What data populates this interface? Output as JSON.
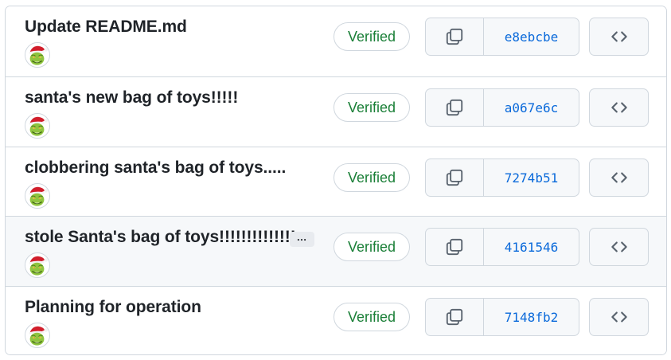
{
  "commits": [
    {
      "message": "Update README.md",
      "verified_label": "Verified",
      "sha": "e8ebcbe",
      "has_more": false,
      "hovered": false
    },
    {
      "message": "santa's new bag of toys!!!!!",
      "verified_label": "Verified",
      "sha": "a067e6c",
      "has_more": false,
      "hovered": false
    },
    {
      "message": "clobbering santa's bag of toys.....",
      "verified_label": "Verified",
      "sha": "7274b51",
      "has_more": false,
      "hovered": false
    },
    {
      "message": "stole Santa's bag of toys!!!!!!!!!!!!!!",
      "verified_label": "Verified",
      "sha": "4161546",
      "has_more": true,
      "more_label": "…",
      "hovered": true
    },
    {
      "message": "Planning for operation",
      "verified_label": "Verified",
      "sha": "7148fb2",
      "has_more": false,
      "hovered": false
    }
  ],
  "icons": {
    "avatar": "grinch-avatar",
    "copy": "copy-icon",
    "browse": "code-icon"
  },
  "colors": {
    "verified": "#1a7f37",
    "sha_link": "#0969da",
    "border": "#d0d7de",
    "hover_row": "#f6f8fa",
    "button_bg": "#f6f8fa"
  }
}
